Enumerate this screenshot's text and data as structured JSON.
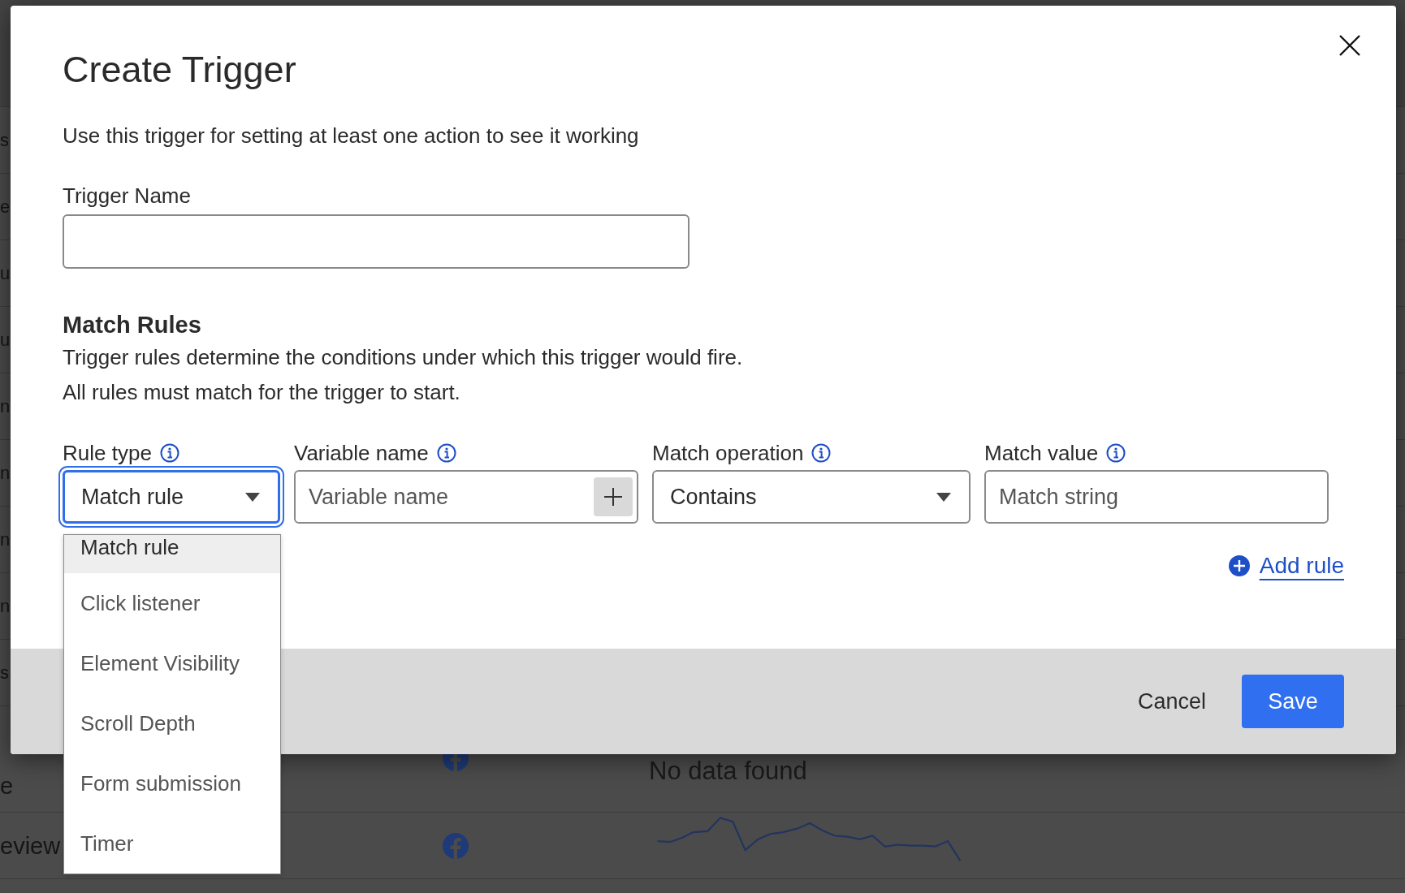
{
  "background": {
    "rows": [
      {
        "lines": [
          "s"
        ]
      },
      {
        "lines": [
          "e"
        ]
      },
      {
        "lines": [
          "u"
        ]
      },
      {
        "lines": [
          "u"
        ]
      },
      {
        "lines": [
          "n"
        ]
      },
      {
        "lines": [
          "n"
        ]
      },
      {
        "lines": [
          "n"
        ]
      },
      {
        "lines": [
          "n"
        ]
      },
      {
        "lines": [
          "s"
        ]
      },
      {
        "lines": [
          "e"
        ],
        "kind": "status",
        "status": "No data found"
      },
      {
        "lines": [
          "eview"
        ],
        "kind": "sparkline"
      }
    ]
  },
  "modal": {
    "title": "Create Trigger",
    "description": "Use this trigger for setting at least one action to see it working",
    "trigger_name": {
      "label": "Trigger Name"
    },
    "match_rules": {
      "heading": "Match Rules",
      "description_lines": [
        "Trigger rules determine the conditions under which this trigger would fire.",
        "All rules must match for the trigger to start."
      ],
      "fields": [
        {
          "kind": "select",
          "label": "Rule type",
          "value": "Match rule",
          "focused": true
        },
        {
          "kind": "input_add",
          "label": "Variable name",
          "placeholder": "Variable name"
        },
        {
          "kind": "select",
          "label": "Match operation",
          "value": "Contains",
          "focused": false
        },
        {
          "kind": "input",
          "label": "Match value",
          "placeholder": "Match string"
        }
      ],
      "dropdown": {
        "options": [
          {
            "label": "Match rule",
            "selected": true
          },
          {
            "label": "Click listener",
            "selected": false
          },
          {
            "label": "Element Visibility",
            "selected": false
          },
          {
            "label": "Scroll Depth",
            "selected": false
          },
          {
            "label": "Form submission",
            "selected": false
          },
          {
            "label": "Timer",
            "selected": false
          }
        ]
      },
      "add_rule": "Add rule"
    },
    "footer": {
      "buttons": [
        {
          "label": "Cancel",
          "kind": "secondary"
        },
        {
          "label": "Save",
          "kind": "primary"
        }
      ]
    }
  }
}
